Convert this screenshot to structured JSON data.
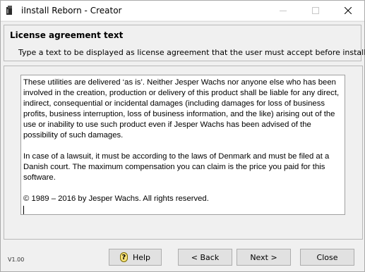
{
  "window": {
    "title": "iInstall Reborn - Creator",
    "icon": "app-icon"
  },
  "header": {
    "title": "License agreement text",
    "subtitle": "Type a text to be displayed as license agreement that the user must accept before installing"
  },
  "license": {
    "paragraph1": "These utilities are delivered ‘as is’. Neither Jesper Wachs nor anyone else who has been involved in the creation, production or delivery of this product shall be liable for any direct, indirect, consequential or incidental damages (including damages for loss of business profits, business interruption, loss of business information, and the like) arising out of the use or inability to use such product even if Jesper Wachs has been advised of the possibility of such damages.",
    "paragraph2": "In case of a lawsuit, it must be according to the laws of Denmark and must be filed at a Danish court. The maximum compensation you can claim is the price you paid for this software.",
    "paragraph3": "© 1989 – 2016 by Jesper Wachs. All rights reserved."
  },
  "footer": {
    "version": "V1.00",
    "help_label": "Help",
    "back_label": "< Back",
    "next_label": "Next >",
    "close_label": "Close"
  }
}
